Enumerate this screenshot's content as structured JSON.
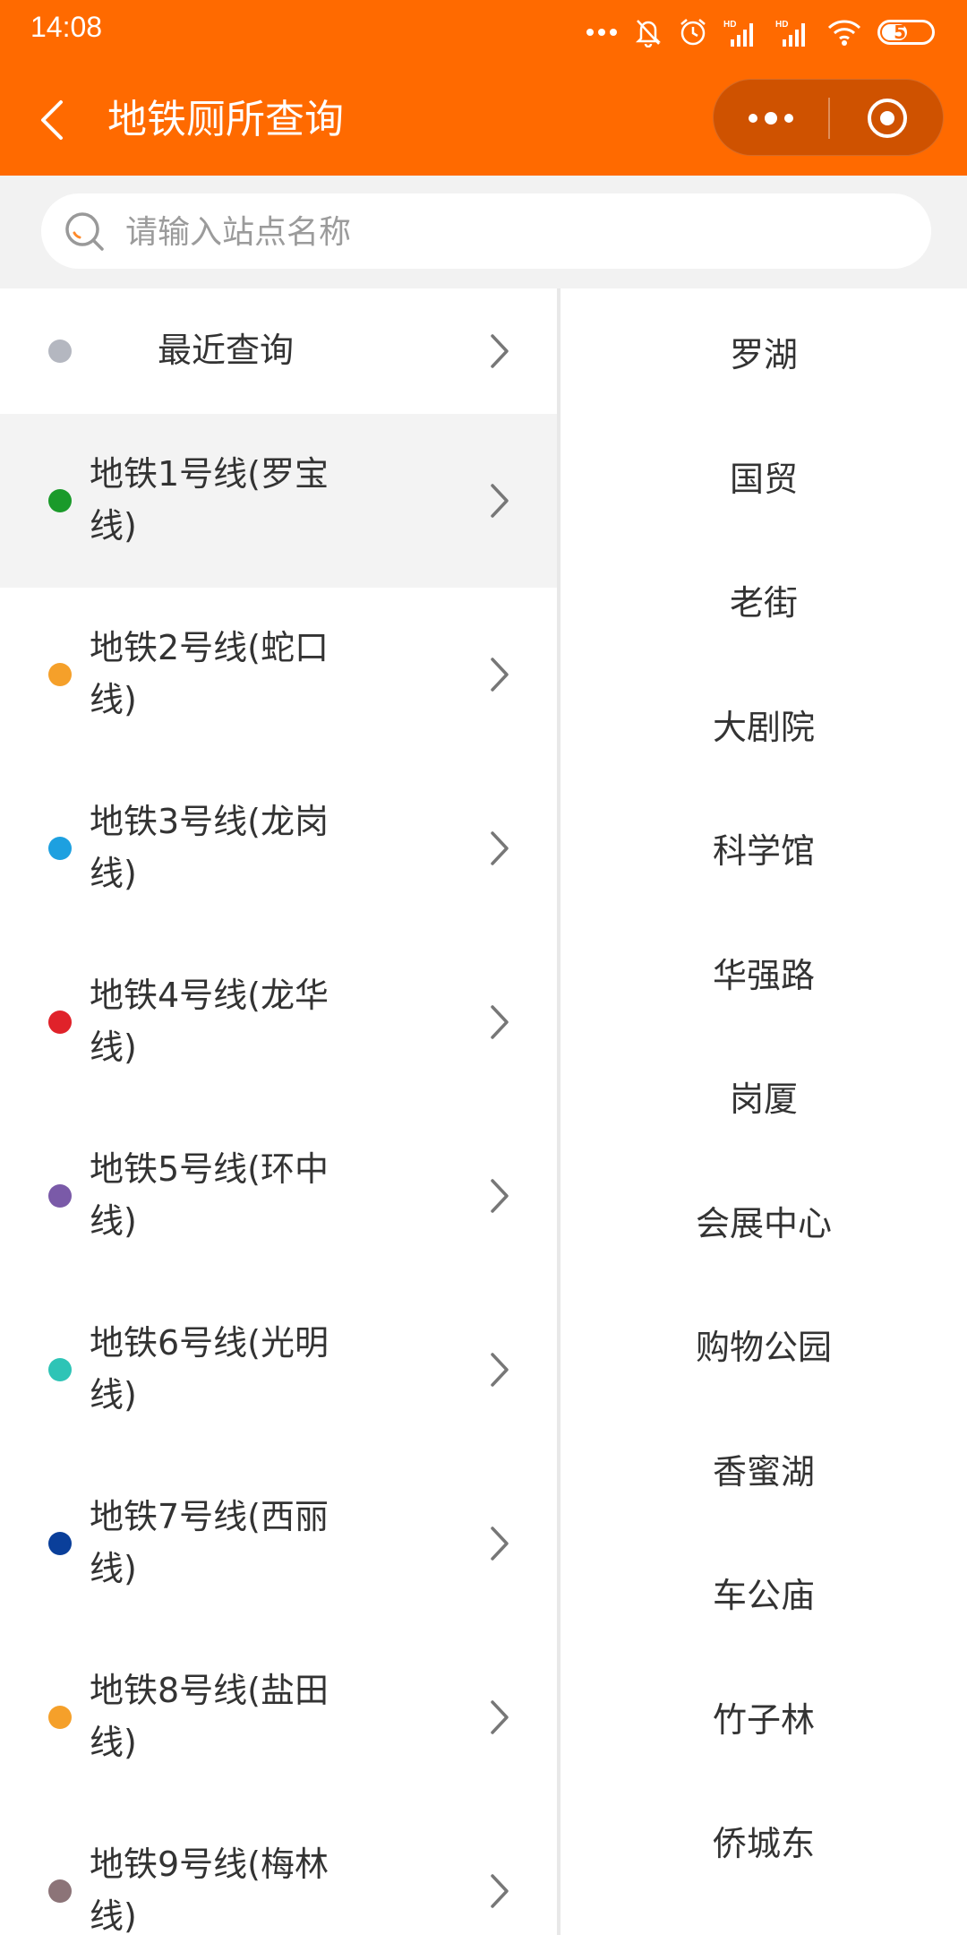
{
  "status_bar": {
    "time": "14:08",
    "battery": "52",
    "battery_level": 0.52
  },
  "nav": {
    "title": "地铁厕所查询"
  },
  "search": {
    "placeholder": "请输入站点名称"
  },
  "lines": [
    {
      "label": "最近查询",
      "color": "#b4b7c0",
      "recent": true
    },
    {
      "label": "地铁1号线(罗宝线)",
      "color": "#1a9a2a",
      "active": true
    },
    {
      "label": "地铁2号线(蛇口线)",
      "color": "#f5a02a"
    },
    {
      "label": "地铁3号线(龙岗线)",
      "color": "#1da0e0"
    },
    {
      "label": "地铁4号线(龙华线)",
      "color": "#e0222a"
    },
    {
      "label": "地铁5号线(环中线)",
      "color": "#7a5aa8"
    },
    {
      "label": "地铁6号线(光明线)",
      "color": "#2ec4b6"
    },
    {
      "label": "地铁7号线(西丽线)",
      "color": "#0a3f9a"
    },
    {
      "label": "地铁8号线(盐田线)",
      "color": "#f5a02a"
    },
    {
      "label": "地铁9号线(梅林线)",
      "color": "#8c7478"
    }
  ],
  "stations": [
    "罗湖",
    "国贸",
    "老街",
    "大剧院",
    "科学馆",
    "华强路",
    "岗厦",
    "会展中心",
    "购物公园",
    "香蜜湖",
    "车公庙",
    "竹子林",
    "侨城东"
  ],
  "colors": {
    "brand": "#ff6a00",
    "capsule": "#cf5200"
  }
}
